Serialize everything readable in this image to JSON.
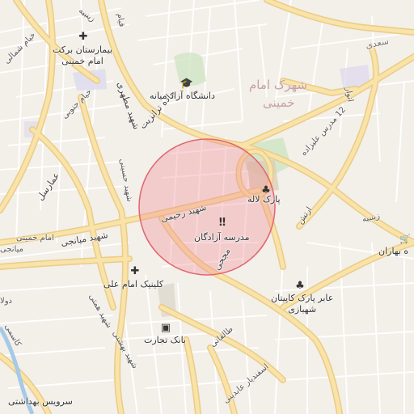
{
  "map": {
    "district": [
      "شهرک امام",
      "خمینی"
    ],
    "highlight_circle": {
      "fill": "#f08a94",
      "stroke": "#e06670"
    },
    "pois": [
      {
        "name": "hospital",
        "icon": "hospital-icon",
        "label": [
          "بیمارستان برکت",
          "امام خمینی"
        ]
      },
      {
        "name": "university",
        "icon": "graduation-cap-icon",
        "label": [
          "دانشگاه آزاد میانه"
        ]
      },
      {
        "name": "school",
        "icon": "school-icon",
        "label": [
          "مدرسه آزادگان"
        ]
      },
      {
        "name": "park",
        "icon": "tree-icon",
        "label": [
          "پارک لاله"
        ]
      },
      {
        "name": "clinic",
        "icon": "clinic-cross-icon",
        "label": [
          "کلینیک امام علی"
        ]
      },
      {
        "name": "bank",
        "icon": "bank-icon",
        "label": [
          "بانک تجارت"
        ]
      },
      {
        "name": "passage-park",
        "icon": "tree-icon",
        "label": [
          "عابر پارک کاپیتان",
          "شهبازی"
        ]
      },
      {
        "name": "health-service",
        "icon": "",
        "label": [
          "سرویس بهداشتی"
        ]
      },
      {
        "name": "bahar",
        "icon": "cart-icon",
        "label": [
          "ه بهاران"
        ]
      }
    ],
    "streets": {
      "janbazan": "جاده ترانزیت",
      "shahid_rahimi": "شهید رحیمی",
      "shahid_mianji": "شهید میانجی",
      "mojahi": "مجحی",
      "shahid_motahari": "شهید مطهری",
      "ammarsal": "عمارسل",
      "khayyam_jonoobi": "خیام جنوبی",
      "khayyam_shomali": "خیام شمالی",
      "shahid_hosseini": "شهید حسینی",
      "shahid_hemmati": "شهید همتی",
      "shahid_bahshti": "شهید بهشتی",
      "taleghani": "طالقانی",
      "esfandiar": "اسفندیار عابدینی",
      "artesh": "ارتش",
      "zeynabieh": "زینبیه",
      "modares": "12 مدرس علیزاده",
      "imam_khomeini": "امام خمینی",
      "saadi": "سعدی",
      "anvar": "انوار",
      "zeynabieh_top": "زینبیه",
      "ghiam": "قیام",
      "mianji_left": "میانجی",
      "kasemi": "کاسمی",
      "dolat": "دولا",
      "shahid_mianji2": "شهید میانجی"
    }
  }
}
